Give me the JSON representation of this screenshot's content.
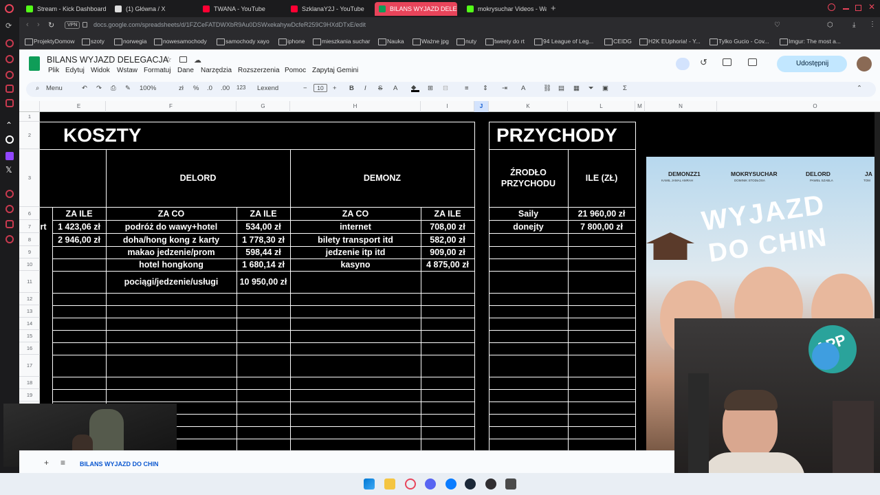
{
  "browser": {
    "tabs": [
      {
        "title": "Stream - Kick Dashboard",
        "color": "#53fc18"
      },
      {
        "title": "(1) Główna / X",
        "color": "#ffffff"
      },
      {
        "title": "TWANA - YouTube",
        "color": "#ff0033"
      },
      {
        "title": "SzklanaY2J - YouTube",
        "color": "#ff0033"
      },
      {
        "title": "BILANS WYJAZD DELEGA",
        "color": "#0f9d58"
      },
      {
        "title": "mokrysuchar Videos - Wa",
        "color": "#53fc18"
      }
    ],
    "url": "docs.google.com/spreadsheets/d/1FZCeFATDWXbR9Au0DSWxekahywDcfeR259C9HXdDTxE/edit",
    "vpn_label": "VPN",
    "bookmarks": [
      "ProjektyDomow",
      "szoty",
      "norwegia",
      "nowesamochody",
      "samochody xayo",
      "iphone",
      "mieszkania suchar",
      "Nauka",
      "Ważne jpg",
      "nuty",
      "tweety do rt",
      "94 League of Leg...",
      "CEIDG",
      "H2K EUphoria! - Y...",
      "Tylko Gucio - Cov...",
      "Imgur: The most a..."
    ]
  },
  "sheets": {
    "doc_title": "BILANS WYJAZD DELEGACJA",
    "menu": [
      "Plik",
      "Edytuj",
      "Widok",
      "Wstaw",
      "Formatuj",
      "Dane",
      "Narzędzia",
      "Rozszerzenia",
      "Pomoc",
      "Zapytaj Gemini"
    ],
    "share_label": "Udostępnij",
    "toolbar": {
      "menu_label": "Menu",
      "zoom": "100%",
      "currency": "zł",
      "percent": "%",
      "dec_less": ".0",
      "dec_more": ".00",
      "number_format": "123",
      "font": "Lexend",
      "font_size": "10",
      "bold": "B",
      "italic": "I",
      "strike": "S",
      "text_color": "A",
      "sum": "Σ"
    },
    "columns": [
      "E",
      "F",
      "G",
      "H",
      "I",
      "J",
      "K",
      "L",
      "M",
      "N",
      "O"
    ],
    "rows": [
      "1",
      "2",
      "3",
      "6",
      "7",
      "8",
      "9",
      "10",
      "11",
      "12",
      "13",
      "14",
      "15",
      "16",
      "17",
      "18",
      "19"
    ],
    "headers": {
      "koszty": "KOSZTY",
      "przychody": "PRZYCHODY",
      "delord": "DELORD",
      "demonz": "DEMONZ",
      "zrodlo": "ŹRODŁO PRZYCHODU",
      "ile": "ILE (ZŁ)",
      "za_ile": "ZA ILE",
      "za_co": "ZA CO"
    },
    "costs": [
      {
        "e_prefix": "rt",
        "e": "1 423,06 zł",
        "f": "podróż do wawy+hotel",
        "g": "534,00 zł",
        "h": "internet",
        "i": "708,00 zł"
      },
      {
        "e_prefix": "",
        "e": "2 946,00 zł",
        "f": "doha/hong kong z karty",
        "g": "1 778,30 zł",
        "h": "bilety transport itd",
        "i": "582,00 zł"
      },
      {
        "e_prefix": "",
        "e": "",
        "f": "makao jedzenie/prom",
        "g": "598,44 zł",
        "h": "jedzenie itp itd",
        "i": "909,00 zł"
      },
      {
        "e_prefix": "",
        "e": "",
        "f": "hotel hongkong",
        "g": "1 680,14 zł",
        "h": "kasyno",
        "i": "4 875,00 zł"
      },
      {
        "e_prefix": "",
        "e": "",
        "f": "pociągi/jedzenie/usługi",
        "g": "10 950,00 zł",
        "h": "",
        "i": ""
      }
    ],
    "income": [
      {
        "source": "Saily",
        "amount": "21 960,00 zł"
      },
      {
        "source": "donejty",
        "amount": "7 800,00 zł"
      }
    ],
    "sheet_tab": "BILANS WYJAZD DO CHIN"
  },
  "poster": {
    "names": [
      "DEMONZZ1",
      "MOKRYSUCHAR",
      "DELORD",
      "JA"
    ],
    "subnames": [
      "KAMIL JAMAL AMRAH",
      "DOMINIK STODŁOSA",
      "PAWEŁ SZABLA",
      "TOM"
    ],
    "title_line1": "WYJAZD",
    "title_line2": "DO CHIN"
  },
  "webcam": {
    "balloon_text": "APP"
  }
}
